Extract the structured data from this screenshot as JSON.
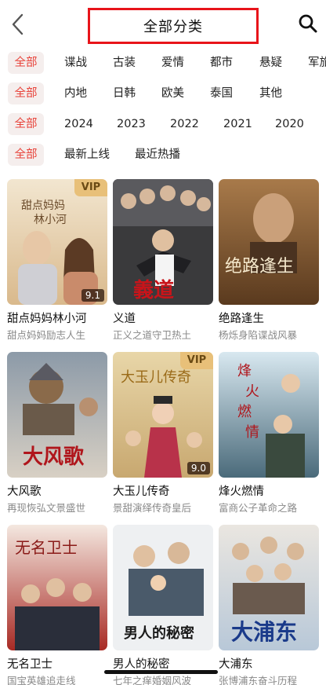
{
  "header": {
    "title": "全部分类",
    "back_icon": "chevron-left-icon",
    "search_icon": "search-icon"
  },
  "filters": {
    "genre": [
      "全部",
      "谍战",
      "古装",
      "爱情",
      "都市",
      "悬疑",
      "军旅"
    ],
    "region": [
      "全部",
      "内地",
      "日韩",
      "欧美",
      "泰国",
      "其他"
    ],
    "year": [
      "全部",
      "2024",
      "2023",
      "2022",
      "2021",
      "2020"
    ],
    "sort": [
      "全部",
      "最新上线",
      "最近热播"
    ]
  },
  "colors": {
    "accent": "#e8433a",
    "selected_bg": "#f5eeed",
    "vip_badge": "#e8c079",
    "title_box_border": "#e8141a"
  },
  "cards": [
    {
      "title": "甜点妈妈林小河",
      "subtitle": "甜点妈妈励志人生",
      "vip": "VIP",
      "score": "9.1",
      "poster_text": "甜点妈妈林小河"
    },
    {
      "title": "义道",
      "subtitle": "正义之道守卫热土",
      "vip": "",
      "score": "",
      "poster_text": "義道"
    },
    {
      "title": "绝路逢生",
      "subtitle": "杨烁身陷谍战风暴",
      "vip": "",
      "score": "",
      "poster_text": "绝路逢生"
    },
    {
      "title": "大风歌",
      "subtitle": "再现恢弘文景盛世",
      "vip": "",
      "score": "",
      "poster_text": "大风歌"
    },
    {
      "title": "大玉儿传奇",
      "subtitle": "景甜演绎传奇皇后",
      "vip": "VIP",
      "score": "9.0",
      "poster_text": "大玉儿传奇"
    },
    {
      "title": "烽火燃情",
      "subtitle": "富商公子革命之路",
      "vip": "",
      "score": "",
      "poster_text": "烽火燃情"
    },
    {
      "title": "无名卫士",
      "subtitle": "国宝英雄追走线",
      "vip": "",
      "score": "",
      "poster_text": "无名卫士"
    },
    {
      "title": "男人的秘密",
      "subtitle": "七年之痒婚姻风波",
      "vip": "",
      "score": "",
      "poster_text": "男人的秘密"
    },
    {
      "title": "大浦东",
      "subtitle": "张博浦东奋斗历程",
      "vip": "",
      "score": "",
      "poster_text": "大浦东"
    }
  ]
}
